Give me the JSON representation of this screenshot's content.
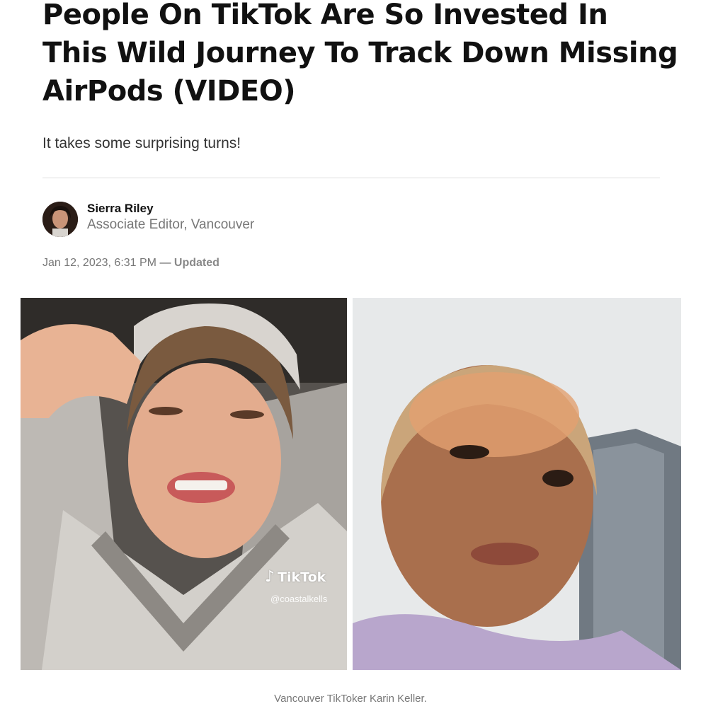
{
  "article": {
    "headline": "People On TikTok Are So Invested In This Wild Journey To Track Down Missing AirPods (VIDEO)",
    "subheadline": "It takes some surprising turns!"
  },
  "author": {
    "name": "Sierra Riley",
    "title": "Associate Editor, Vancouver"
  },
  "meta": {
    "published": "Jan 12, 2023, 6:31 PM",
    "separator": "—",
    "updated_label": "Updated"
  },
  "image": {
    "watermark_brand": "TikTok",
    "watermark_handle": "@coastalkells",
    "caption": "Vancouver TikToker Karin Keller."
  }
}
